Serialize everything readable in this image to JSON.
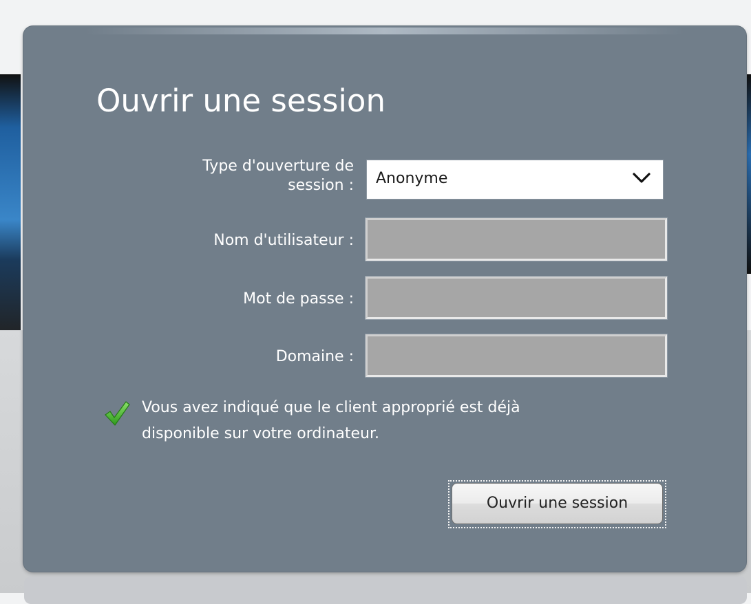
{
  "dialog": {
    "title": "Ouvrir une session",
    "fields": {
      "session_type_label": "Type d'ouverture de session :",
      "session_type_value": "Anonyme",
      "username_label": "Nom d'utilisateur :",
      "username_value": "",
      "password_label": "Mot de passe :",
      "password_value": "",
      "domain_label": "Domaine :",
      "domain_value": ""
    },
    "notice": {
      "icon": "checkmark-icon",
      "text": "Vous avez indiqué que le client approprié est déjà disponible sur votre ordinateur."
    },
    "submit_label": "Ouvrir une session"
  },
  "colors": {
    "dialog_bg": "#717e8a",
    "field_bg": "#a6a6a6",
    "check_green": "#3fae2a"
  }
}
